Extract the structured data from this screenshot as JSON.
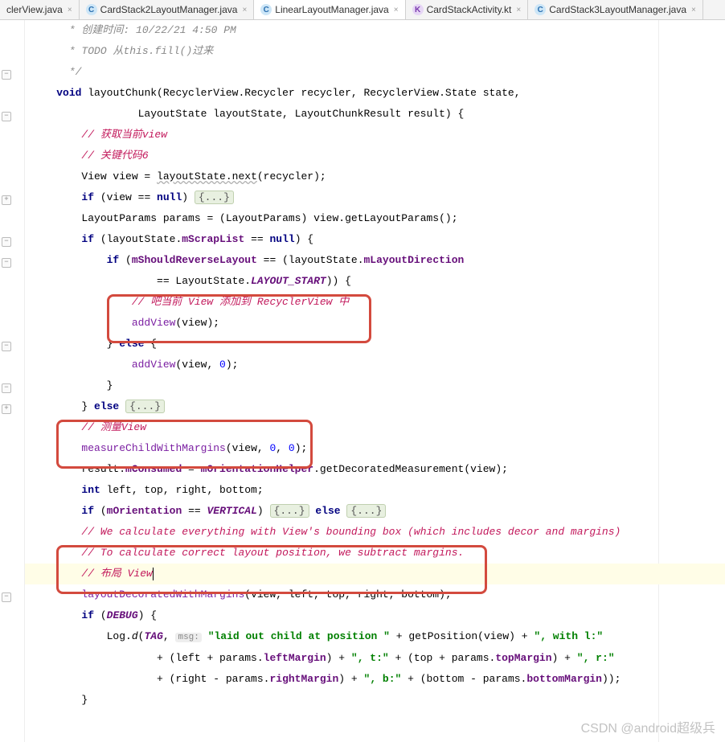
{
  "tabs": [
    {
      "label": "clerView.java",
      "icon": "",
      "active": false
    },
    {
      "label": "CardStack2LayoutManager.java",
      "icon": "C",
      "active": false
    },
    {
      "label": "LinearLayoutManager.java",
      "icon": "C",
      "active": true
    },
    {
      "label": "CardStackActivity.kt",
      "icon": "K",
      "active": false
    },
    {
      "label": "CardStack3LayoutManager.java",
      "icon": "C",
      "active": false
    }
  ],
  "code": {
    "l1_a": " * 创建时间: ",
    "l1_b": "10/22/21 4:50 PM",
    "l2_a": " * TODO 从",
    "l2_b": "this.fill()",
    "l2_c": "过来",
    "l3": " */",
    "l4_a": "void",
    "l4_b": " layoutChunk(RecyclerView.Recycler recycler, RecyclerView.State state,",
    "l5": "                 LayoutState layoutState, LayoutChunkResult result) {",
    "l6": "// 获取当前view",
    "l7": "// 关键代码6",
    "l8_a": "View view = ",
    "l8_b": "layoutState.next",
    "l8_c": "(recycler);",
    "l9_a": "if",
    "l9_b": " (view == ",
    "l9_c": "null",
    "l9_d": ") ",
    "l9_fold": "{...}",
    "l10_a": "LayoutParams params = (LayoutParams) view.getLayoutParams();",
    "l11_a": "if",
    "l11_b": " (layoutState.",
    "l11_c": "mScrapList",
    "l11_d": " == ",
    "l11_e": "null",
    "l11_f": ") {",
    "l12_a": "if",
    "l12_b": " (",
    "l12_c": "mShouldReverseLayout",
    "l12_d": " == (layoutState.",
    "l12_e": "mLayoutDirection",
    "l13_a": "== LayoutState.",
    "l13_b": "LAYOUT_START",
    "l13_c": ")) {",
    "l14": "// 吧当前 View 添加到 RecyclerView 中",
    "l15_a": "addView",
    "l15_b": "(view);",
    "l16_a": "} ",
    "l16_b": "else",
    "l16_c": " {",
    "l17_a": "addView",
    "l17_b": "(view, ",
    "l17_c": "0",
    "l17_d": ");",
    "l18": "}",
    "l19_a": "} ",
    "l19_b": "else",
    "l19_c": " ",
    "l19_fold": "{...}",
    "l20": "// 测量View",
    "l21_a": "measureChildWithMargins",
    "l21_b": "(view, ",
    "l21_c": "0",
    "l21_d": ", ",
    "l21_e": "0",
    "l21_f": ");",
    "l22_a": "result.",
    "l22_b": "mConsumed",
    "l22_c": " = ",
    "l22_d": "mOrientationHelper",
    "l22_e": ".getDecoratedMeasurement(view);",
    "l23_a": "int",
    "l23_b": " left, top, right, bottom;",
    "l24_a": "if",
    "l24_b": " (",
    "l24_c": "mOrientation",
    "l24_d": " == ",
    "l24_e": "VERTICAL",
    "l24_f": ") ",
    "l24_fold1": "{...}",
    "l24_g": " ",
    "l24_h": "else",
    "l24_i": " ",
    "l24_fold2": "{...}",
    "l25": "// We calculate everything with View's bounding box (which includes decor and margins)",
    "l26": "// To calculate correct layout position, we subtract margins.",
    "l27": "// 布局 View",
    "l28_a": "layoutDecoratedWithMargins",
    "l28_b": "(view, left, top, right, bottom);",
    "l29_a": "if",
    "l29_b": " (",
    "l29_c": "DEBUG",
    "l29_d": ") {",
    "l30_a": "Log.",
    "l30_b": "d",
    "l30_c": "(",
    "l30_d": "TAG",
    "l30_e": ", ",
    "l30_hint": "msg:",
    "l30_f": " ",
    "l30_g": "\"laid out child at position \"",
    "l30_h": " + getPosition(view) + ",
    "l30_i": "\", with l:\"",
    "l31_a": "+ (left + params.",
    "l31_b": "leftMargin",
    "l31_c": ") + ",
    "l31_d": "\", t:\"",
    "l31_e": " + (top + params.",
    "l31_f": "topMargin",
    "l31_g": ") + ",
    "l31_h": "\", r:\"",
    "l32_a": "+ (right - params.",
    "l32_b": "rightMargin",
    "l32_c": ") + ",
    "l32_d": "\", b:\"",
    "l32_e": " + (bottom - params.",
    "l32_f": "bottomMargin",
    "l32_g": "));",
    "l33": "}"
  },
  "watermark": "CSDN @android超级兵"
}
